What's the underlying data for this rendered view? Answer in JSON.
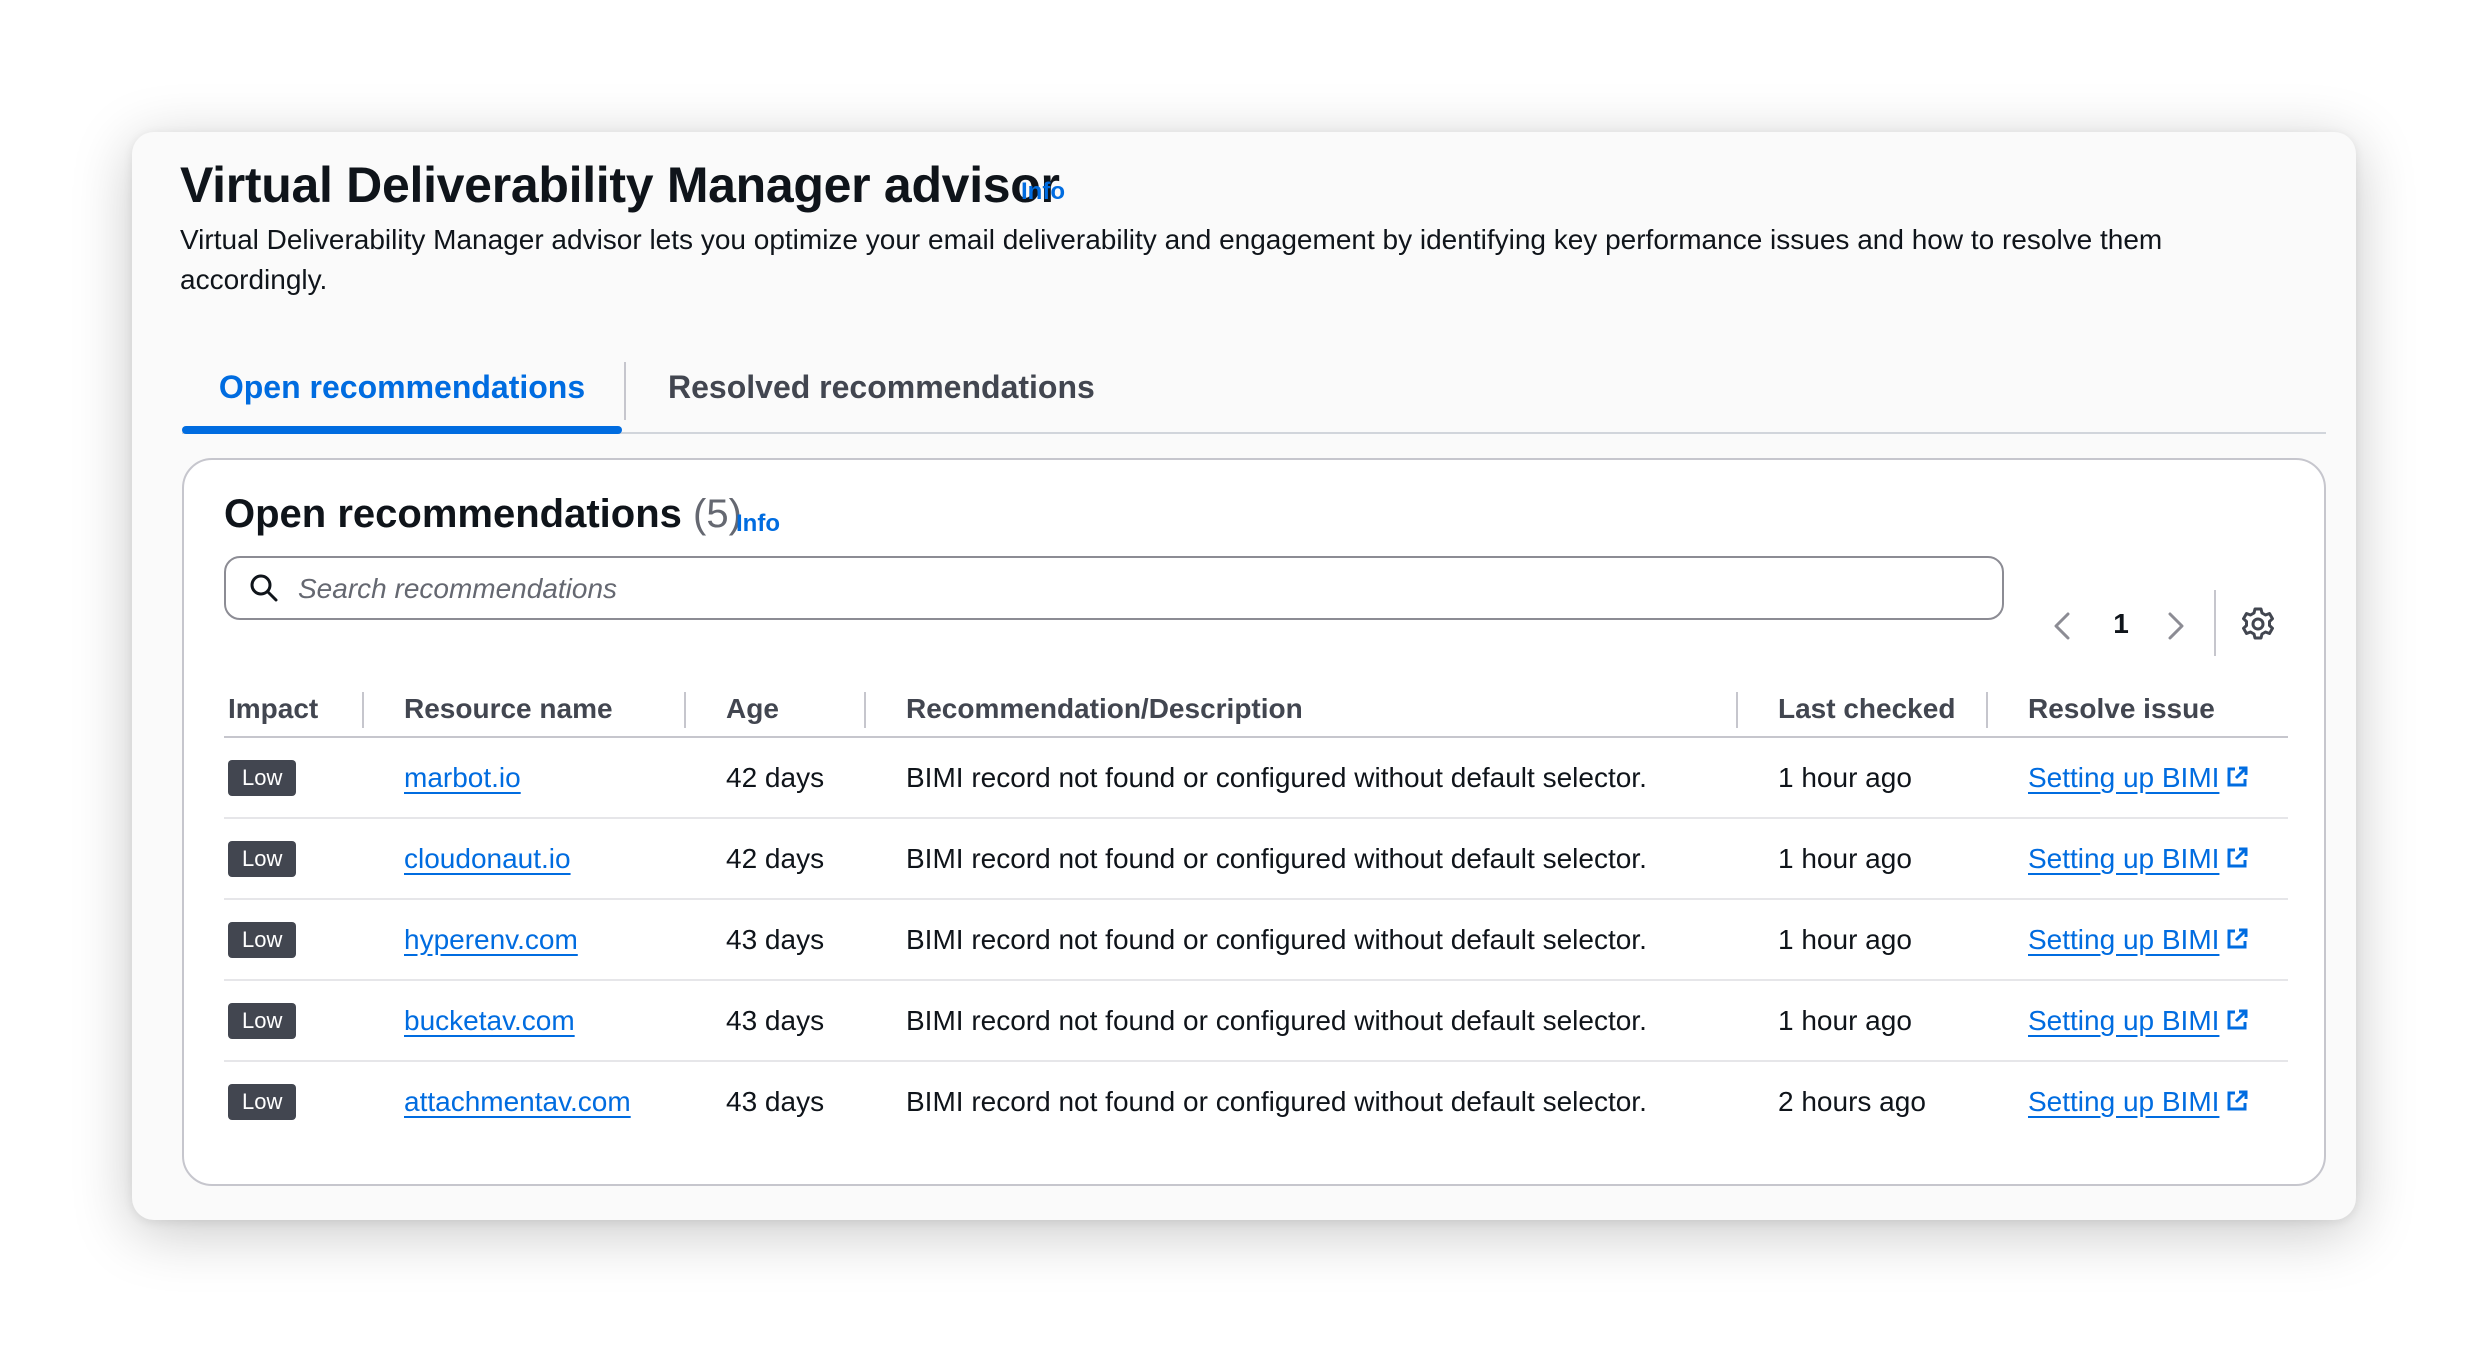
{
  "header": {
    "title": "Virtual Deliverability Manager advisor",
    "info_label": "Info",
    "description": "Virtual Deliverability Manager advisor lets you optimize your email deliverability and engagement by identifying key performance issues and how to resolve them accordingly."
  },
  "tabs": [
    {
      "label": "Open recommendations",
      "active": true
    },
    {
      "label": "Resolved recommendations",
      "active": false
    }
  ],
  "panel": {
    "title": "Open recommendations",
    "count": "(5)",
    "info_label": "Info",
    "search_placeholder": "Search recommendations",
    "page_number": "1"
  },
  "table": {
    "columns": [
      "Impact",
      "Resource name",
      "Age",
      "Recommendation/Description",
      "Last checked",
      "Resolve issue"
    ],
    "rows": [
      {
        "impact": "Low",
        "resource": "marbot.io",
        "age": "42 days",
        "description": "BIMI record not found or configured without default selector.",
        "last_checked": "1 hour ago",
        "resolve": "Setting up BIMI"
      },
      {
        "impact": "Low",
        "resource": "cloudonaut.io",
        "age": "42 days",
        "description": "BIMI record not found or configured without default selector.",
        "last_checked": "1 hour ago",
        "resolve": "Setting up BIMI"
      },
      {
        "impact": "Low",
        "resource": "hyperenv.com",
        "age": "43 days",
        "description": "BIMI record not found or configured without default selector.",
        "last_checked": "1 hour ago",
        "resolve": "Setting up BIMI"
      },
      {
        "impact": "Low",
        "resource": "bucketav.com",
        "age": "43 days",
        "description": "BIMI record not found or configured without default selector.",
        "last_checked": "1 hour ago",
        "resolve": "Setting up BIMI"
      },
      {
        "impact": "Low",
        "resource": "attachmentav.com",
        "age": "43 days",
        "description": "BIMI record not found or configured without default selector.",
        "last_checked": "2 hours ago",
        "resolve": "Setting up BIMI"
      }
    ]
  },
  "colors": {
    "accent": "#006ce0",
    "badge": "#424650",
    "border": "#c6c6cd"
  },
  "icons": {
    "search": "search-icon",
    "prev": "chevron-left-icon",
    "next": "chevron-right-icon",
    "settings": "gear-icon",
    "external": "external-link-icon"
  }
}
